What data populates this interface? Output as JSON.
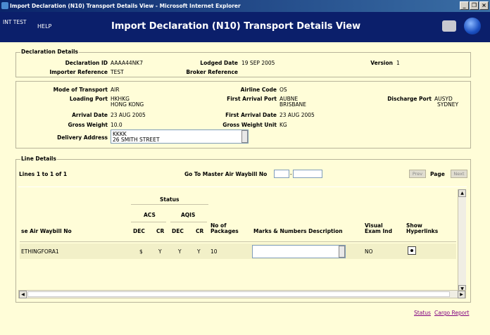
{
  "window": {
    "title": "Import Declaration (N10) Transport Details View - Microsoft Internet Explorer",
    "min": "_",
    "max": "❐",
    "close": "×"
  },
  "app": {
    "name": "INT TEST",
    "help": "HELP",
    "page_title": "Import Declaration (N10) Transport Details View"
  },
  "declaration_details": {
    "legend": "Declaration Details",
    "declaration_id_label": "Declaration ID",
    "declaration_id": "AAAA44NK7",
    "lodged_date_label": "Lodged Date",
    "lodged_date": "19 SEP 2005",
    "version_label": "Version",
    "version": "1",
    "importer_reference_label": "Importer Reference",
    "importer_reference": "TEST",
    "broker_reference_label": "Broker Reference",
    "broker_reference": ""
  },
  "transport": {
    "mode_label": "Mode of Transport",
    "mode": "AIR",
    "airline_code_label": "Airline Code",
    "airline_code": "OS",
    "loading_port_label": "Loading Port",
    "loading_port_code": "HKHKG",
    "loading_port_name": "HONG KONG",
    "first_arrival_port_label": "First Arrival Port",
    "first_arrival_port_code": "AUBNE",
    "first_arrival_port_name": "BRISBANE",
    "discharge_port_label": "Discharge Port",
    "discharge_port_code": "AUSYD",
    "discharge_port_name": "SYDNEY",
    "arrival_date_label": "Arrival Date",
    "arrival_date": "23 AUG 2005",
    "first_arrival_date_label": "First Arrival Date",
    "first_arrival_date": "23 AUG 2005",
    "gross_weight_label": "Gross Weight",
    "gross_weight": "10.0",
    "gross_weight_unit_label": "Gross Weight Unit",
    "gross_weight_unit": "KG",
    "delivery_address_label": "Delivery Address",
    "delivery_address_line1": "KKKK",
    "delivery_address_line2": "26 SMITH STREET"
  },
  "line_details": {
    "legend": "Line Details",
    "lines_text": "Lines 1 to 1 of 1",
    "goto_label": "Go To Master Air Waybill No",
    "goto_sep": "-",
    "prev": "Prev",
    "page_label": "Page",
    "next": "Next",
    "headers": {
      "status": "Status",
      "acs": "ACS",
      "aqis": "AQIS",
      "waybill": "se Air Waybill No",
      "dec1": "DEC",
      "cr1": "CR",
      "dec2": "DEC",
      "cr2": "CR",
      "packages_1": "No of",
      "packages_2": "Packages",
      "marks": "Marks & Numbers Description",
      "visual_1": "Visual",
      "visual_2": "Exam Ind",
      "show_1": "Show",
      "show_2": "Hyperlinks"
    },
    "rows": [
      {
        "waybill": "ETHINGFORA1",
        "acs_dec": "$",
        "acs_cr": "Y",
        "aqis_dec": "Y",
        "aqis_cr": "Y",
        "packages": "10",
        "marks": "",
        "visual_exam": "NO",
        "show_hyperlinks": true
      }
    ]
  },
  "footer_links": {
    "status": "Status",
    "cargo_report": "Cargo Report"
  }
}
